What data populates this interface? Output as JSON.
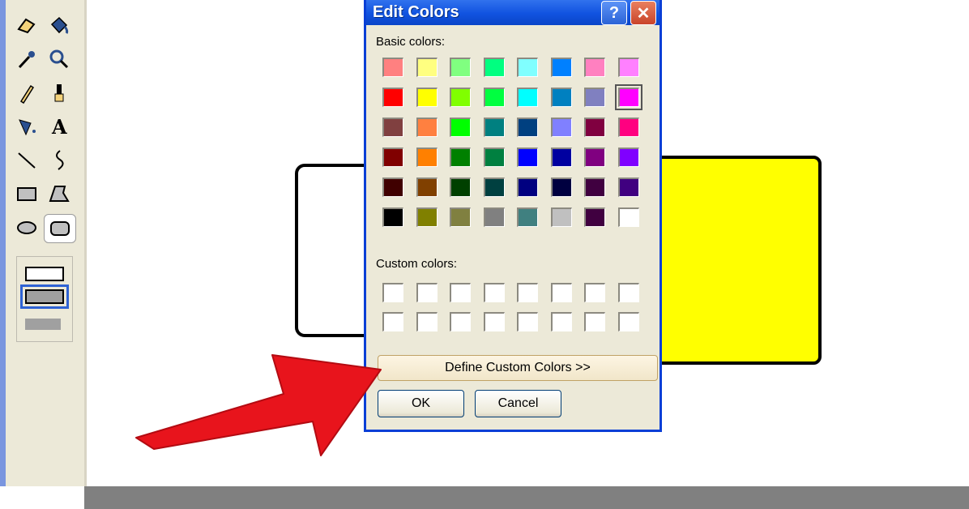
{
  "dialog": {
    "title": "Edit Colors",
    "help_glyph": "?",
    "close_glyph": "✕",
    "basic_label": "Basic colors:",
    "custom_label": "Custom colors:",
    "define_button": "Define Custom Colors >>",
    "ok_button": "OK",
    "cancel_button": "Cancel"
  },
  "basic_colors": [
    [
      "#ff8080",
      "#ffff80",
      "#80ff80",
      "#00ff80",
      "#80ffff",
      "#0080ff",
      "#ff80c0",
      "#ff80ff"
    ],
    [
      "#ff0000",
      "#ffff00",
      "#80ff00",
      "#00ff40",
      "#00ffff",
      "#0080c0",
      "#8080c0",
      "#ff00ff"
    ],
    [
      "#804040",
      "#ff8040",
      "#00ff00",
      "#008080",
      "#004080",
      "#8080ff",
      "#800040",
      "#ff0080"
    ],
    [
      "#800000",
      "#ff8000",
      "#008000",
      "#008040",
      "#0000ff",
      "#0000a0",
      "#800080",
      "#8000ff"
    ],
    [
      "#400000",
      "#804000",
      "#004000",
      "#004040",
      "#000080",
      "#000040",
      "#400040",
      "#400080"
    ],
    [
      "#000000",
      "#808000",
      "#808040",
      "#808080",
      "#408080",
      "#c0c0c0",
      "#400040",
      "#ffffff"
    ]
  ],
  "selected_color": "#ff00ff",
  "toolbox": {
    "tools": [
      "eraser-icon",
      "fill-bucket-icon",
      "eyedropper-icon",
      "magnifier-icon",
      "pencil-icon",
      "brush-icon",
      "airbrush-icon",
      "text-icon",
      "line-icon",
      "curve-icon",
      "rectangle-icon",
      "polygon-icon",
      "ellipse-icon",
      "rounded-rectangle-icon"
    ],
    "selected_tool": "rounded-rectangle-icon"
  },
  "annotation_color": "#e8141c",
  "shape_fill_color": "#ffff00"
}
